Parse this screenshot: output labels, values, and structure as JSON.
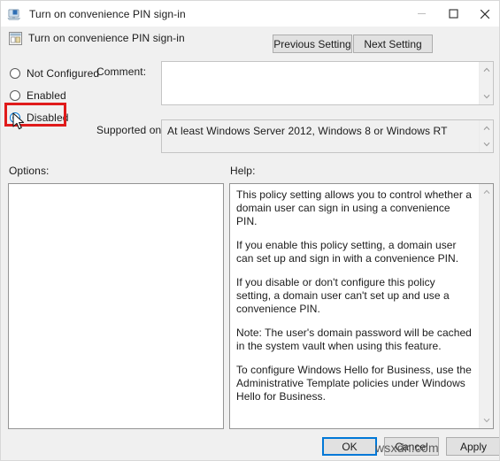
{
  "window": {
    "title": "Turn on convenience PIN sign-in",
    "icon": "computer-policy-icon",
    "controls": {
      "minimize": "minimize-icon",
      "maximize": "maximize-icon",
      "close": "close-icon"
    }
  },
  "header": {
    "policy_name": "Turn on convenience PIN sign-in",
    "policy_icon": "policy-setting-icon",
    "previous_setting": "Previous Setting",
    "next_setting": "Next Setting"
  },
  "state_options": {
    "items": [
      {
        "label": "Not Configured",
        "selected": false
      },
      {
        "label": "Enabled",
        "selected": false
      },
      {
        "label": "Disabled",
        "selected": true
      }
    ],
    "highlight_color": "#e01b1b"
  },
  "comment": {
    "label": "Comment:",
    "value": "",
    "placeholder": ""
  },
  "supported_on": {
    "label": "Supported on:",
    "value": "At least Windows Server 2012, Windows 8 or Windows RT"
  },
  "options": {
    "label": "Options:",
    "content": ""
  },
  "help": {
    "label": "Help:",
    "paragraphs": [
      "This policy setting allows you to control whether a domain user can sign in using a convenience PIN.",
      "If you enable this policy setting, a domain user can set up and sign in with a convenience PIN.",
      "If you disable or don't configure this policy setting, a domain user can't set up and use a convenience PIN.",
      "Note: The user's domain password will be cached in the system vault when using this feature.",
      "To configure Windows Hello for Business, use the Administrative Template policies under Windows Hello for Business."
    ]
  },
  "footer": {
    "ok": "OK",
    "cancel": "Cancel",
    "apply": "Apply"
  },
  "watermark": "wsxdn.com",
  "colors": {
    "accent": "#0078d7",
    "dialog_bg": "#f0f0f0",
    "annotation": "#e01b1b"
  }
}
